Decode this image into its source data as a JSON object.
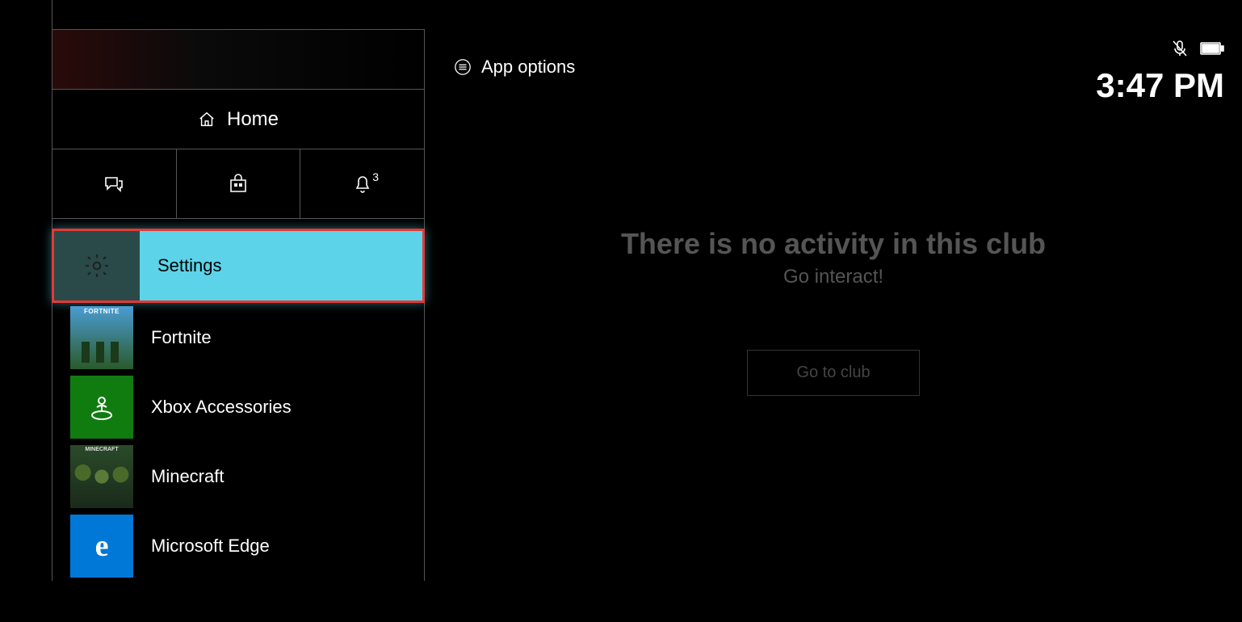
{
  "header": {
    "app_options_label": "App options",
    "clock": "3:47 PM"
  },
  "sidebar": {
    "home_label": "Home",
    "notification_badge": "3",
    "items": [
      {
        "label": "Settings",
        "selected": true
      },
      {
        "label": "Fortnite",
        "selected": false
      },
      {
        "label": "Xbox Accessories",
        "selected": false
      },
      {
        "label": "Minecraft",
        "selected": false
      },
      {
        "label": "Microsoft Edge",
        "selected": false
      }
    ]
  },
  "content": {
    "title": "There is no activity in this club",
    "subtitle": "Go interact!",
    "button_label": "Go to club"
  }
}
